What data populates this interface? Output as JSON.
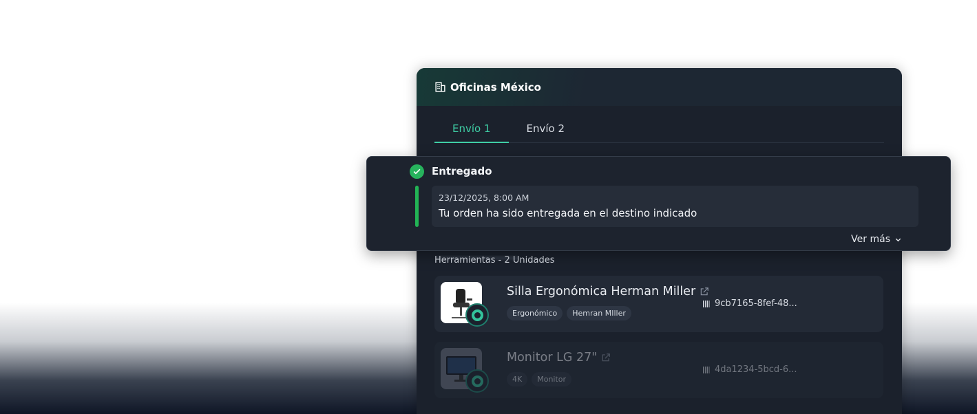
{
  "card": {
    "title": "Oficinas México",
    "tabs": [
      {
        "label": "Envío 1",
        "active": true
      },
      {
        "label": "Envío 2",
        "active": false
      }
    ]
  },
  "status": {
    "title": "Entregado",
    "date": "23/12/2025, 8:00 AM",
    "message": "Tu orden ha sido entregada en el destino indicado",
    "more_label": "Ver más"
  },
  "products": {
    "section_label": "Herramientas - 2 Unidades",
    "items": [
      {
        "name": "Silla Ergonómica Herman Miller",
        "tags": [
          "Ergonómico",
          "Hemran MIller"
        ],
        "serial": "9cb7165-8fef-48..."
      },
      {
        "name": "Monitor LG 27\"",
        "tags": [
          "4K",
          "Monitor"
        ],
        "serial": "4da1234-5bcd-6..."
      }
    ]
  },
  "colors": {
    "accent": "#3fcfa6",
    "success": "#22b455",
    "card_bg": "#1b212c"
  }
}
